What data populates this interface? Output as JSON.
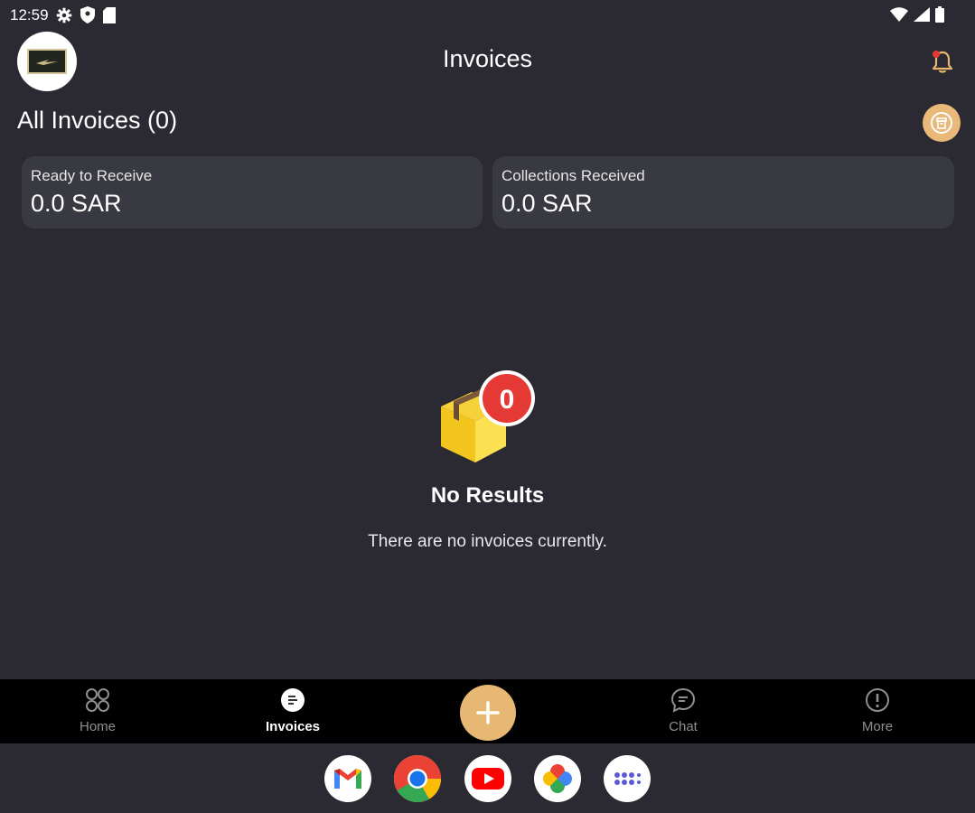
{
  "status_bar": {
    "time": "12:59"
  },
  "header": {
    "title": "Invoices"
  },
  "section": {
    "title": "All Invoices (0)"
  },
  "cards": [
    {
      "label": "Ready to Receive",
      "value": "0.0 SAR"
    },
    {
      "label": "Collections Received",
      "value": "0.0 SAR"
    }
  ],
  "empty_state": {
    "badge": "0",
    "title": "No Results",
    "subtitle": "There are no invoices currently."
  },
  "bottom_nav": {
    "items": [
      {
        "label": "Home",
        "icon": "grid-icon",
        "active": false
      },
      {
        "label": "Invoices",
        "icon": "invoice-icon",
        "active": true
      },
      {
        "label": "Chat",
        "icon": "chat-icon",
        "active": false
      },
      {
        "label": "More",
        "icon": "info-icon",
        "active": false
      }
    ],
    "fab_icon": "plus-icon"
  },
  "dock": {
    "apps": [
      "gmail-icon",
      "chrome-icon",
      "youtube-icon",
      "photos-icon",
      "app-drawer-icon"
    ]
  },
  "colors": {
    "background": "#2b2a33",
    "card": "#393941",
    "accent": "#e7b874",
    "badge": "#e53935",
    "nav_bg": "#000000"
  }
}
